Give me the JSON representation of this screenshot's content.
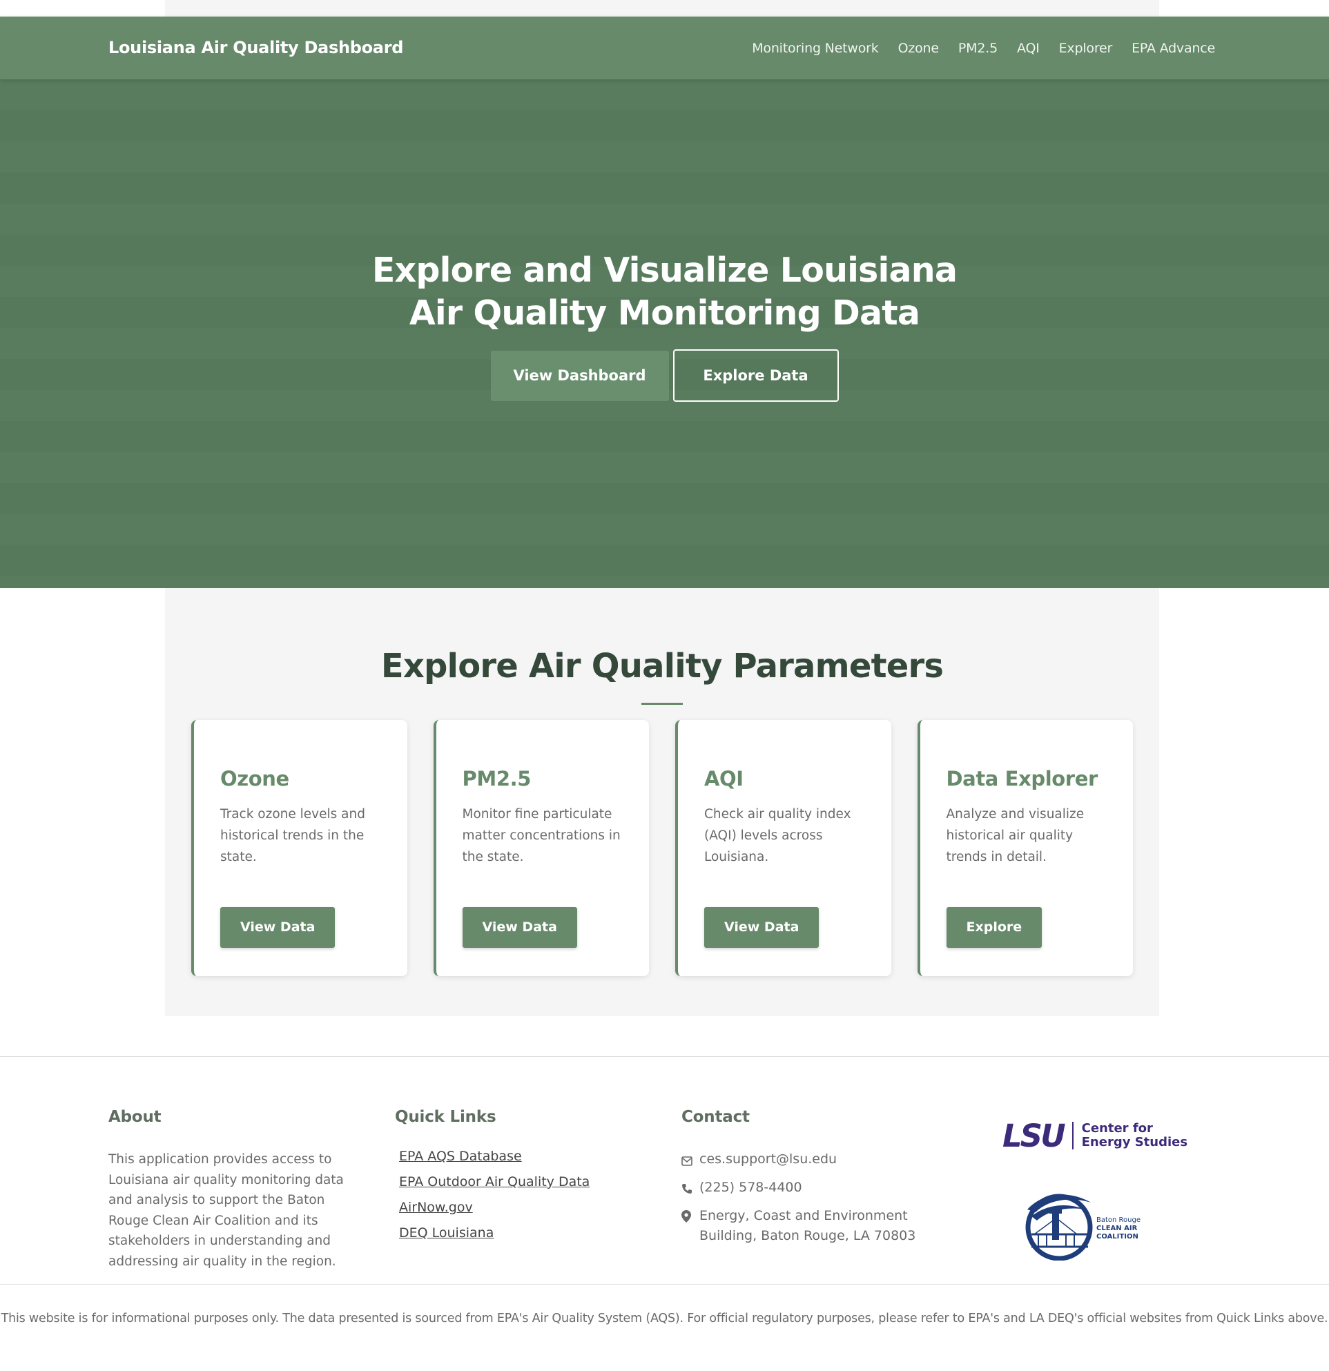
{
  "navbar": {
    "brand": "Louisiana Air Quality Dashboard",
    "links": [
      "Monitoring Network",
      "Ozone",
      "PM2.5",
      "AQI",
      "Explorer",
      "EPA Advance"
    ]
  },
  "hero": {
    "title": "Explore and Visualize Louisiana Air Quality Monitoring Data",
    "primary_button": "View Dashboard",
    "secondary_button": "Explore Data"
  },
  "parameters": {
    "heading": "Explore Air Quality Parameters",
    "cards": [
      {
        "title": "Ozone",
        "description": "Track ozone levels and historical trends in the state.",
        "button": "View Data"
      },
      {
        "title": "PM2.5",
        "description": "Monitor fine particulate matter concentrations in the state.",
        "button": "View Data"
      },
      {
        "title": "AQI",
        "description": "Check air quality index (AQI) levels across Louisiana.",
        "button": "View Data"
      },
      {
        "title": "Data Explorer",
        "description": "Analyze and visualize historical air quality trends in detail.",
        "button": "Explore"
      }
    ]
  },
  "footer": {
    "about": {
      "heading": "About",
      "text": "This application provides access to Louisiana air quality monitoring data and analysis to support the Baton Rouge Clean Air Coalition and its stakeholders in understanding and addressing air quality in the region."
    },
    "quick_links": {
      "heading": "Quick Links",
      "links": [
        "EPA AQS Database",
        "EPA Outdoor Air Quality Data",
        "AirNow.gov",
        "DEQ Louisiana"
      ]
    },
    "contact": {
      "heading": "Contact",
      "email": "ces.support@lsu.edu",
      "phone": "(225) 578-4400",
      "address": "Energy, Coast and Environment Building, Baton Rouge, LA 70803"
    },
    "logos": {
      "lsu_word": "LSU",
      "lsu_text_line1": "Center for",
      "lsu_text_line2": "Energy Studies",
      "coalition_line1": "Baton Rouge",
      "coalition_line2": "CLEAN AIR COALITION"
    },
    "disclaimer": "This website is for informational purposes only. The data presented is sourced from EPA's Air Quality System (AQS). For official regulatory purposes, please refer to EPA's and LA DEQ's official websites from Quick Links above."
  },
  "colors": {
    "primary": "#668a6a",
    "hero_bg": "#587a5c",
    "heading": "#34493a",
    "lsu_purple": "#3c2a7a"
  },
  "icons": {
    "email": "envelope-icon",
    "phone": "phone-icon",
    "address": "map-marker-icon"
  }
}
